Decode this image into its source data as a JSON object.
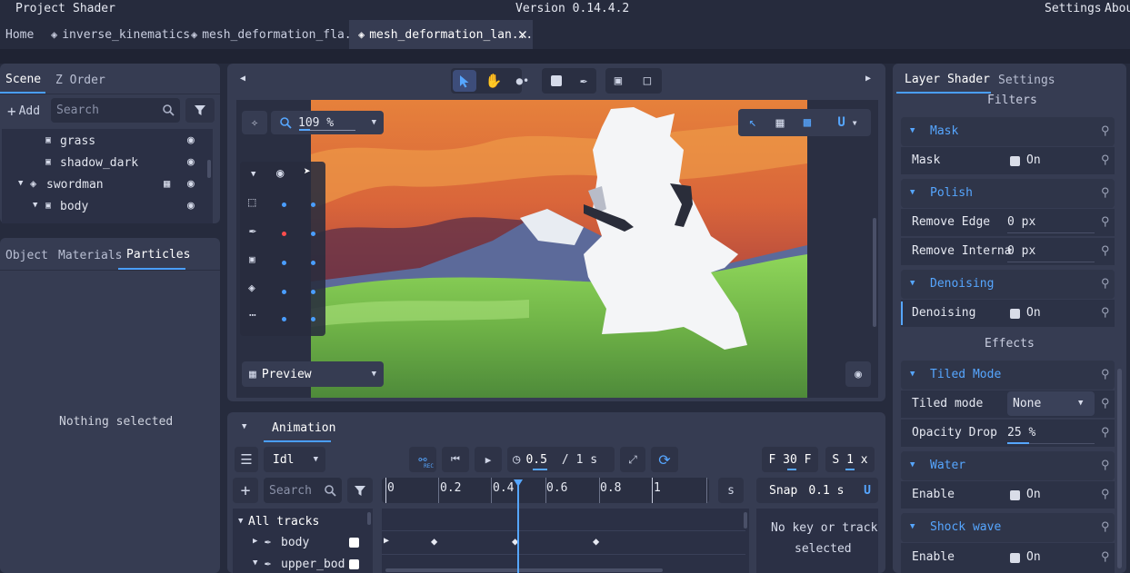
{
  "menubar": {
    "project": "Project",
    "shader": "Shader",
    "version": "Version 0.14.4.2",
    "settings": "Settings",
    "about": "Abou"
  },
  "tabs": [
    {
      "label": "Home"
    },
    {
      "label": "inverse_kinematics"
    },
    {
      "label": "mesh_deformation_fla..."
    },
    {
      "label": "mesh_deformation_lan..."
    }
  ],
  "scene_panel": {
    "tab_scene": "Scene",
    "tab_zorder": "Z Order",
    "add_label": "Add",
    "search_placeholder": "Search",
    "items": [
      {
        "label": "grass"
      },
      {
        "label": "shadow_dark"
      },
      {
        "label": "swordman"
      },
      {
        "label": "body"
      }
    ]
  },
  "object_panel": {
    "tab_object": "Object",
    "tab_materials": "Materials",
    "tab_particles": "Particles",
    "empty": "Nothing selected"
  },
  "viewport": {
    "zoom": "109 %",
    "preview": "Preview"
  },
  "animation": {
    "title": "Animation",
    "clip": "Idl",
    "time": "0.5",
    "duration": "/ 1 s",
    "fps": "F 30 F",
    "step": "S 1 x",
    "search_placeholder": "Search",
    "ruler": [
      "0",
      "0.2",
      "0.4",
      "0.6",
      "0.8",
      "1"
    ],
    "ruler_unit": "s",
    "snap_label": "Snap",
    "snap_value": "0.1 s",
    "all_tracks": "All tracks",
    "tracks": [
      {
        "label": "body"
      },
      {
        "label": "upper_bod"
      }
    ],
    "no_key": "No key or track",
    "selected": "selected",
    "rec": "REC"
  },
  "right_panel": {
    "tab_layer_shader": "Layer Shader",
    "tab_settings": "Settings",
    "filters": "Filters",
    "mask_section": "Mask",
    "mask_label": "Mask",
    "mask_value": "On",
    "polish_section": "Polish",
    "remove_edge_label": "Remove Edge",
    "remove_edge_value": "0 px",
    "remove_internal_label": "Remove Interna",
    "remove_internal_value": "0 px",
    "denoising_section": "Denoising",
    "denoising_label": "Denoising",
    "denoising_value": "On",
    "effects": "Effects",
    "tiled_section": "Tiled Mode",
    "tiled_label": "Tiled mode",
    "tiled_value": "None",
    "opacity_label": "Opacity Drop",
    "opacity_value": "25 %",
    "water_section": "Water",
    "water_enable": "Enable",
    "water_value": "On",
    "shock_section": "Shock wave",
    "shock_enable": "Enable",
    "shock_value": "On"
  },
  "colors": {
    "accent": "#4a9eff",
    "panel": "#363c52",
    "background": "#262b3d",
    "sky_top": "#e0713a",
    "grass": "#7ac24a"
  }
}
